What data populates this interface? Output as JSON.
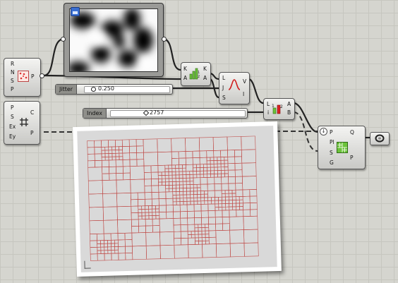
{
  "populate": {
    "inputs": [
      "R",
      "N",
      "S",
      "P"
    ],
    "output": "P"
  },
  "rectangle": {
    "inputs": [
      "P",
      "S",
      "Ex",
      "Ey"
    ],
    "outputs": [
      "C",
      "P"
    ]
  },
  "sort": {
    "inputs": [
      "K",
      "A"
    ],
    "outputs": [
      "K",
      "A"
    ]
  },
  "jitter_comp": {
    "inputs": [
      "L",
      "J",
      "S"
    ],
    "outputs": [
      "V",
      "I"
    ]
  },
  "item": {
    "inputs": [
      "L",
      "i"
    ],
    "outputs": [
      "A",
      "B"
    ]
  },
  "substrate": {
    "inputs": [
      "P",
      "Pl",
      "S",
      "G"
    ],
    "outputs": [
      "Q",
      "P"
    ]
  },
  "sliders": [
    {
      "label": "Jitter",
      "value": "0.250",
      "knob": "circle"
    },
    {
      "label": "Index",
      "value": "2757",
      "knob": "diamond"
    }
  ],
  "preview": {
    "icon": "image-icon"
  },
  "output_param": {
    "icon": "ring-icon"
  }
}
